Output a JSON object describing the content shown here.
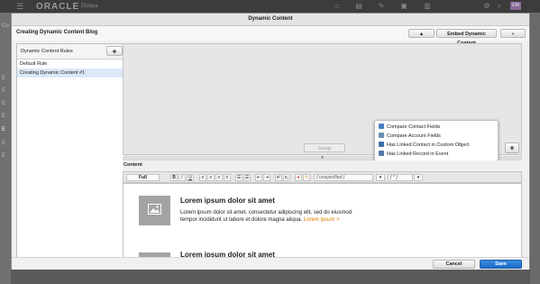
{
  "app": {
    "logo": "ORACLE",
    "product": "Eloqua",
    "topbar_icons": [
      "home-icon",
      "assets-icon",
      "campaigns-icon",
      "contacts-icon",
      "insight-icon",
      "settings-icon",
      "search-icon",
      "avatar"
    ],
    "avatar_initials": "EM",
    "bg_side_letters": [
      "Co",
      "E",
      "E",
      "E",
      "E",
      "E",
      "E",
      "E"
    ]
  },
  "dialog": {
    "title": "Dynamic Content",
    "subheader_title": "Creating Dynamic Content Blog",
    "warning_icon": "triangle-icon",
    "embed_label": "Embed Dynamic Content",
    "expand_label": "»"
  },
  "rules_panel": {
    "header": "Dynamic Content Rules",
    "add_label": "+",
    "items": [
      "Default Rule",
      "Creating Dynamic Content #1"
    ],
    "selected_index": 1
  },
  "canvas": {
    "group_label": "Group",
    "add_label": "+",
    "splitter_glyph": "▾"
  },
  "add_menu": {
    "items": [
      {
        "label": "Compare Contact Fields",
        "icon": "contact-fields-icon",
        "color": "#4a7fc1"
      },
      {
        "label": "Compare Account Fields",
        "icon": "account-fields-icon",
        "color": "#6b8fb5"
      },
      {
        "label": "Has Linked Contact in Custom Object",
        "icon": "custom-object-icon",
        "color": "#3b6ea8"
      },
      {
        "label": "Has Linked Record in Event",
        "icon": "event-icon",
        "color": "#5779a8"
      }
    ]
  },
  "content": {
    "label": "Content",
    "toolbar": {
      "view_mode": "Full",
      "bold": "B",
      "italic": "I",
      "underline": "U",
      "superscript": "x²",
      "subscript": "x₂",
      "font_placeholder": "( unspecified )",
      "size_placeholder": "( * )"
    },
    "blocks": [
      {
        "heading": "Lorem ipsum dolor sit amet",
        "body": "Lorem ipsum dolor sit amet, consectetur adipiscing elit, sed do eiusmod tempor incididunt ut labore et dolore magna aliqua.",
        "link": "Lorem ipsum >"
      },
      {
        "heading": "Lorem ipsum dolor sit amet"
      }
    ]
  },
  "footer": {
    "cancel_label": "Cancel",
    "save_label": "Save"
  },
  "colors": {
    "accent": "#1c6cc8",
    "link": "#e07b00"
  }
}
